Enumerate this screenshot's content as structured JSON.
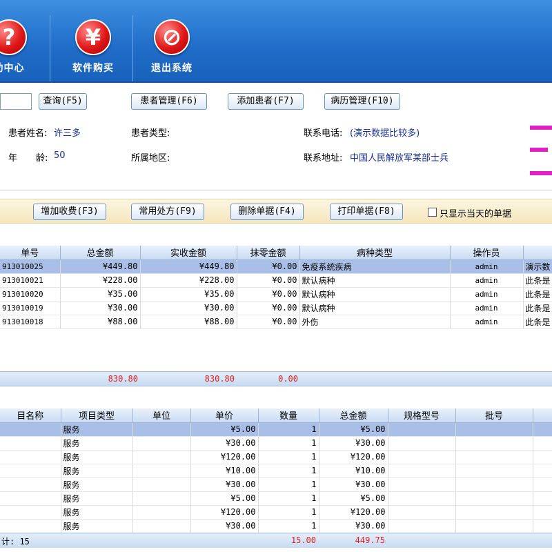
{
  "toolbar": {
    "help_label": "助中心",
    "buy_label": "软件购买",
    "exit_label": "退出系统",
    "help_glyph": "?",
    "buy_glyph": "¥",
    "exit_glyph": "⊘"
  },
  "actions": {
    "query": "查询(F5)",
    "patient_manage": "患者管理(F6)",
    "add_patient": "添加患者(F7)",
    "records": "病历管理(F10)"
  },
  "patient": {
    "name_label": "患者姓名:",
    "name": "许三多",
    "type_label": "患者类型:",
    "type": "",
    "phone_label": "联系电话:",
    "phone": "(演示数据比较多)",
    "age_label_a": "年",
    "age_label_b": "龄:",
    "age": "50",
    "region_label": "所属地区:",
    "region": "",
    "address_label": "联系地址:",
    "address": "中国人民解放军某部士兵"
  },
  "bill_actions": {
    "add_fee": "增加收费(F3)",
    "common_rx": "常用处方(F9)",
    "delete_bill": "删除单据(F4)",
    "print_bill": "打印单据(F8)",
    "today_only": "只显示当天的单据"
  },
  "bills": {
    "headers": [
      "单号",
      "总金额",
      "实收金额",
      "抹零金额",
      "病种类型",
      "操作员",
      ""
    ],
    "rows": [
      [
        "913010025",
        "¥449.80",
        "¥449.80",
        "¥0.00",
        "免疫系统疾病",
        "admin",
        "演示数"
      ],
      [
        "913010021",
        "¥228.00",
        "¥228.00",
        "¥0.00",
        "默认病种",
        "admin",
        "此条是"
      ],
      [
        "913010020",
        "¥35.00",
        "¥35.00",
        "¥0.00",
        "默认病种",
        "admin",
        "此条是"
      ],
      [
        "913010019",
        "¥30.00",
        "¥30.00",
        "¥0.00",
        "默认病种",
        "admin",
        "此条是"
      ],
      [
        "913010018",
        "¥88.00",
        "¥88.00",
        "¥0.00",
        "外伤",
        "admin",
        "此条是"
      ]
    ],
    "totals": {
      "total": "830.80",
      "received": "830.80",
      "rounding": "0.00"
    }
  },
  "items": {
    "headers": [
      "目名称",
      "项目类型",
      "单位",
      "单价",
      "数量",
      "总金额",
      "规格型号",
      "批号",
      ""
    ],
    "rows": [
      [
        "",
        "服务",
        "",
        "¥5.00",
        "1",
        "¥5.00",
        "",
        "",
        ""
      ],
      [
        "",
        "服务",
        "",
        "¥30.00",
        "1",
        "¥30.00",
        "",
        "",
        ""
      ],
      [
        "",
        "服务",
        "",
        "¥120.00",
        "1",
        "¥120.00",
        "",
        "",
        ""
      ],
      [
        "",
        "服务",
        "",
        "¥10.00",
        "1",
        "¥10.00",
        "",
        "",
        ""
      ],
      [
        "",
        "服务",
        "",
        "¥30.00",
        "1",
        "¥30.00",
        "",
        "",
        ""
      ],
      [
        "",
        "服务",
        "",
        "¥5.00",
        "1",
        "¥5.00",
        "",
        "",
        ""
      ],
      [
        "",
        "服务",
        "",
        "¥120.00",
        "1",
        "¥120.00",
        "",
        "",
        ""
      ],
      [
        "",
        "服务",
        "",
        "¥30.00",
        "1",
        "¥30.00",
        "",
        "",
        ""
      ]
    ],
    "footer_count": "计: 15",
    "footer_qty": "15.00",
    "footer_total": "449.75"
  }
}
